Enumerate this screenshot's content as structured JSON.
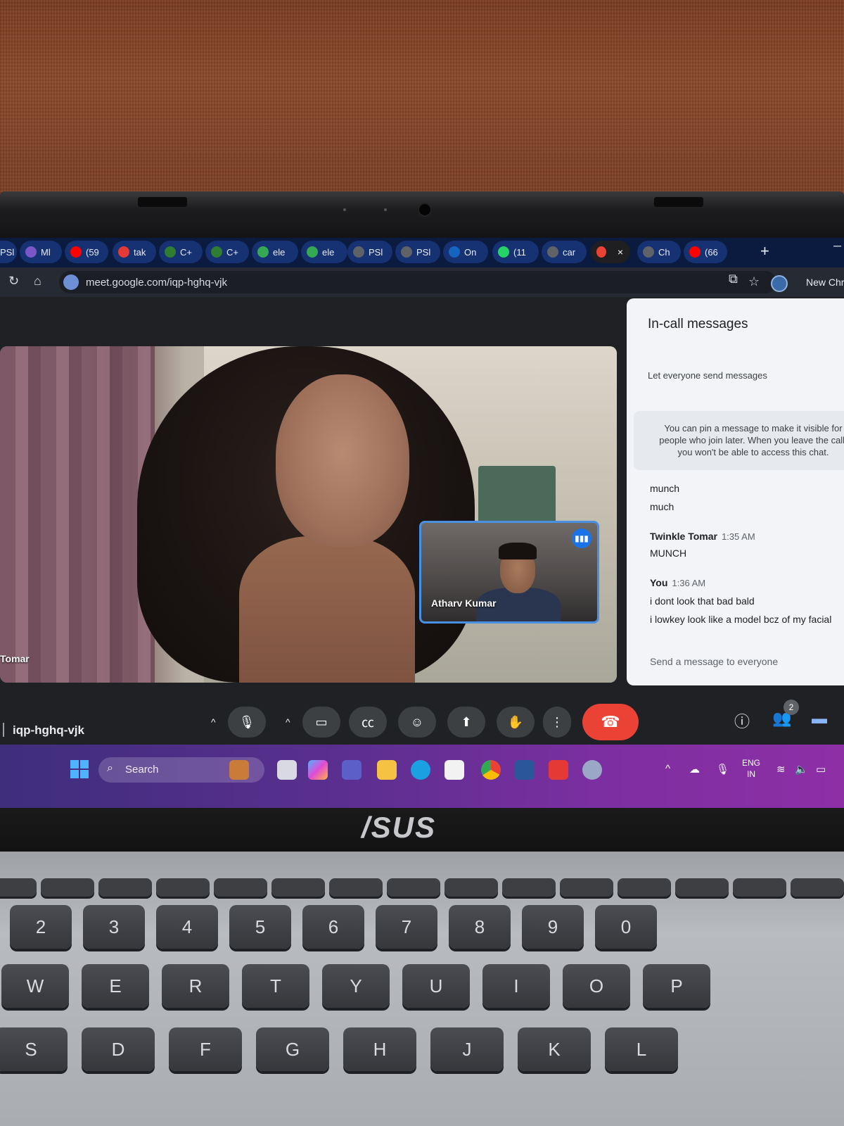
{
  "browser": {
    "tabs": [
      {
        "label": "PSl",
        "icon": "globe-icon",
        "color": "#4a67b5"
      },
      {
        "label": "Ml",
        "icon": "app-icon",
        "color": "#7a57c7"
      },
      {
        "label": "(59",
        "icon": "youtube-icon",
        "color": "#ff0000"
      },
      {
        "label": "tak",
        "icon": "app-icon",
        "color": "#e53935"
      },
      {
        "label": "C+",
        "icon": "w-icon",
        "color": "#2e7d32"
      },
      {
        "label": "C+",
        "icon": "app-icon",
        "color": "#2e7d32"
      },
      {
        "label": "ele",
        "icon": "drive-icon",
        "color": "#34a853"
      },
      {
        "label": "ele",
        "icon": "drive-icon",
        "color": "#34a853"
      },
      {
        "label": "PSl",
        "icon": "globe-icon",
        "color": "#5f6368"
      },
      {
        "label": "PSl",
        "icon": "globe-icon",
        "color": "#5f6368"
      },
      {
        "label": "On",
        "icon": "p-icon",
        "color": "#1565c0"
      },
      {
        "label": "(11",
        "icon": "whatsapp-icon",
        "color": "#25d366"
      },
      {
        "label": "car",
        "icon": "globe-icon",
        "color": "#5f6368"
      },
      {
        "label": "",
        "icon": "meet-recording-icon",
        "color": "#ea4335"
      },
      {
        "label": "Ch",
        "icon": "chatgpt-icon",
        "color": "#5f6368"
      },
      {
        "label": "(66",
        "icon": "youtube-icon",
        "color": "#ff0000"
      }
    ],
    "new_tab_symbol": "+",
    "url": "meet.google.com/iqp-hghq-vjk",
    "profile_label": "New Chr"
  },
  "meet": {
    "main_participant_name": "Tomar",
    "self_tile_name": "Atharv Kumar",
    "meeting_code": "iqp-hghq-vjk",
    "participant_count": "2",
    "chat": {
      "title": "In-call messages",
      "setting_label": "Let everyone send messages",
      "info_text": "You can pin a message to make it visible for people who join later. When you leave the call, you won't be able to access this chat.",
      "messages": [
        {
          "text": "munch"
        },
        {
          "text": "much"
        }
      ],
      "groups": [
        {
          "sender": "Twinkle Tomar",
          "time": "1:35 AM",
          "lines": [
            "MUNCH"
          ]
        },
        {
          "sender": "You",
          "time": "1:36 AM",
          "lines": [
            "i dont look that bad bald",
            "i lowkey look like a model bcz of my facial"
          ]
        }
      ],
      "input_placeholder": "Send a message to everyone"
    }
  },
  "taskbar": {
    "search_label": "Search",
    "lang_line1": "ENG",
    "lang_line2": "IN"
  },
  "laptop": {
    "brand": "/SUS",
    "number_row": [
      "2",
      "3",
      "4",
      "5",
      "6",
      "7",
      "8",
      "9",
      "0"
    ],
    "top_letter_row": [
      "W",
      "E",
      "R",
      "T",
      "Y",
      "U",
      "I",
      "O",
      "P"
    ],
    "home_row": [
      "S",
      "D",
      "F",
      "G",
      "H",
      "J",
      "K",
      "L"
    ]
  }
}
